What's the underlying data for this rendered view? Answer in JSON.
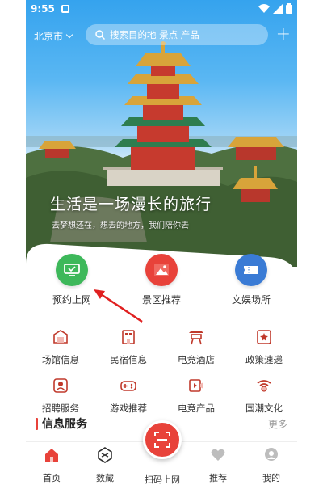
{
  "status": {
    "time": "9:55"
  },
  "header": {
    "city": "北京市",
    "search_placeholder": "搜索目的地 景点 产品"
  },
  "hero": {
    "slogan": "生活是一场漫长的旅行",
    "subtitle": "去梦想还在，想去的地方，我们陪你去"
  },
  "features": [
    {
      "label": "预约上网",
      "icon": "monitor-icon",
      "color": "#3db85a"
    },
    {
      "label": "景区推荐",
      "icon": "mountain-icon",
      "color": "#e8423a"
    },
    {
      "label": "文娱场所",
      "icon": "ticket-icon",
      "color": "#3a7bd5"
    }
  ],
  "grid": [
    {
      "label": "场馆信息",
      "icon": "venue-icon"
    },
    {
      "label": "民宿信息",
      "icon": "homestay-icon"
    },
    {
      "label": "电竞酒店",
      "icon": "esports-hotel-icon"
    },
    {
      "label": "政策速递",
      "icon": "policy-icon"
    },
    {
      "label": "招聘服务",
      "icon": "recruit-icon"
    },
    {
      "label": "游戏推荐",
      "icon": "gamepad-icon"
    },
    {
      "label": "电竞产品",
      "icon": "video-icon"
    },
    {
      "label": "国潮文化",
      "icon": "culture-icon"
    }
  ],
  "section": {
    "title": "信息服务",
    "more": "更多"
  },
  "nav": [
    {
      "label": "首页",
      "icon": "home-icon"
    },
    {
      "label": "数藏",
      "icon": "collection-icon"
    },
    {
      "label": "扫码上网",
      "icon": "scan-icon"
    },
    {
      "label": "推荐",
      "icon": "heart-icon"
    },
    {
      "label": "我的",
      "icon": "profile-icon"
    }
  ],
  "colors": {
    "accent": "#e8423a",
    "grid_icon": "#c0392b"
  }
}
